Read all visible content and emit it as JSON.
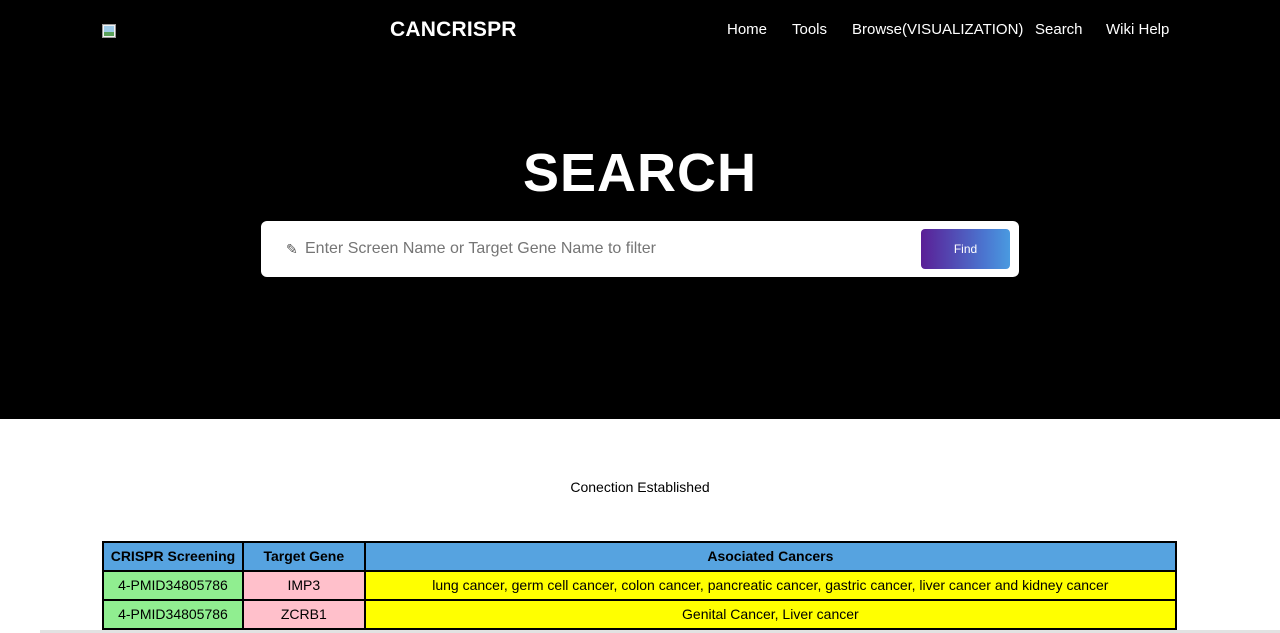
{
  "header": {
    "brand": "CANCRISPR",
    "nav": [
      "Home",
      "Tools",
      "Browse(VISUALIZATION)",
      "Search",
      "Wiki Help"
    ]
  },
  "hero": {
    "title": "SEARCH",
    "search": {
      "placeholder": "Enter Screen Name or Target Gene Name to filter",
      "value": "",
      "button_label": "Find"
    }
  },
  "status_text": "Conection Established",
  "table": {
    "headers": [
      "CRISPR Screening",
      "Target Gene",
      "Asociated Cancers"
    ],
    "rows": [
      [
        "4-PMID34805786",
        "IMP3",
        "lung cancer, germ cell cancer, colon cancer, pancreatic cancer, gastric cancer, liver cancer and kidney cancer"
      ],
      [
        "4-PMID34805786",
        "ZCRB1",
        "Genital Cancer, Liver cancer"
      ]
    ]
  },
  "colors": {
    "hero_bg": "#000000",
    "header_cell": "#56a3e0",
    "screening_cell": "#90ee90",
    "gene_cell": "#ffc0cb",
    "cancer_cell": "#ffff00",
    "button_gradient": [
      "#5a1f96",
      "#4a9ae0"
    ]
  }
}
